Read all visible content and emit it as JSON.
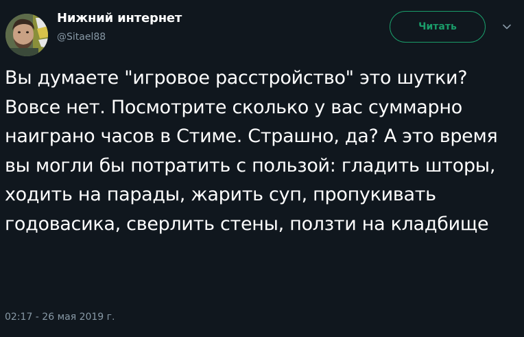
{
  "author": {
    "name": "Нижний интернет",
    "handle": "@Sitael88"
  },
  "follow_button": {
    "label": "Читать"
  },
  "tweet": {
    "text": "Вы думаете \"игровое расстройство\" это шутки? Вовсе нет. Посмотрите сколько у вас суммарно наиграно часов в Стиме. Страшно, да? А это время вы могли бы потратить с пользой: гладить шторы, ходить на парады, жарить суп, пропукивать годовасика, сверлить стены, ползти на кладбище",
    "timestamp": "02:17 - 26 мая 2019 г."
  },
  "icons": {
    "avatar": "user-avatar",
    "menu": "chevron-down-icon"
  },
  "colors": {
    "background": "#10171e",
    "accent": "#1a9d6a",
    "secondary_text": "#8899a6"
  }
}
